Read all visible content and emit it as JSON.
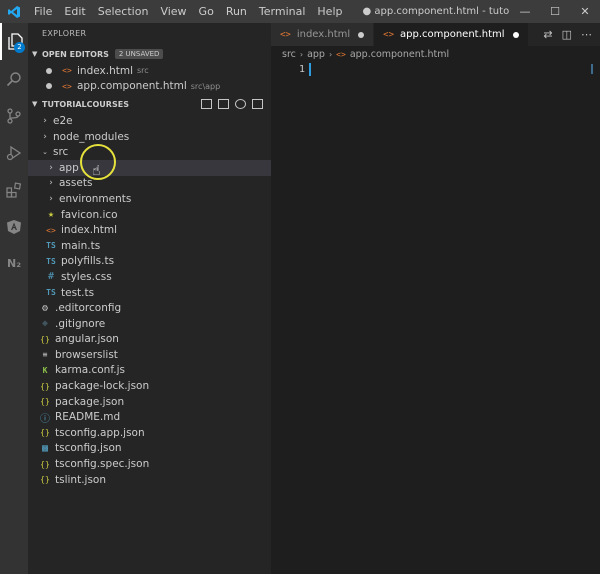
{
  "titlebar": {
    "menu": [
      "File",
      "Edit",
      "Selection",
      "View",
      "Go",
      "Run",
      "Terminal",
      "Help"
    ],
    "window_title": "● app.component.html - tutorialCourses - Visual Studio..."
  },
  "activity": {
    "explorer_badge": "2"
  },
  "sidebar": {
    "title": "EXPLORER",
    "open_editors": {
      "label": "OPEN EDITORS",
      "unsaved": "2 UNSAVED",
      "items": [
        {
          "name": "index.html",
          "path": "src"
        },
        {
          "name": "app.component.html",
          "path": "src\\app"
        }
      ]
    },
    "project": {
      "label": "TUTORIALCOURSES",
      "tree": [
        {
          "name": "e2e",
          "type": "folder"
        },
        {
          "name": "node_modules",
          "type": "folder"
        },
        {
          "name": "src",
          "type": "folder-open"
        },
        {
          "name": "app",
          "type": "folder"
        },
        {
          "name": "assets",
          "type": "folder"
        },
        {
          "name": "environments",
          "type": "folder"
        },
        {
          "name": "favicon.ico",
          "type": "star"
        },
        {
          "name": "index.html",
          "type": "html"
        },
        {
          "name": "main.ts",
          "type": "ts"
        },
        {
          "name": "polyfills.ts",
          "type": "ts"
        },
        {
          "name": "styles.css",
          "type": "css"
        },
        {
          "name": "test.ts",
          "type": "ts"
        },
        {
          "name": ".editorconfig",
          "type": "gear"
        },
        {
          "name": ".gitignore",
          "type": "git"
        },
        {
          "name": "angular.json",
          "type": "json"
        },
        {
          "name": "browserslist",
          "type": "list"
        },
        {
          "name": "karma.conf.js",
          "type": "karma"
        },
        {
          "name": "package-lock.json",
          "type": "json"
        },
        {
          "name": "package.json",
          "type": "json"
        },
        {
          "name": "README.md",
          "type": "info"
        },
        {
          "name": "tsconfig.app.json",
          "type": "json"
        },
        {
          "name": "tsconfig.json",
          "type": "tsconfig"
        },
        {
          "name": "tsconfig.spec.json",
          "type": "json"
        },
        {
          "name": "tslint.json",
          "type": "json"
        }
      ]
    }
  },
  "editor": {
    "tabs": [
      {
        "label": "index.html",
        "active": false
      },
      {
        "label": "app.component.html",
        "active": true
      }
    ],
    "breadcrumb": [
      "src",
      "app",
      "app.component.html"
    ],
    "line_number": "1"
  },
  "colors": {
    "accent": "#007acc",
    "html_icon": "#e37933",
    "ts_icon": "#519aba",
    "json_icon": "#cbcb41",
    "click_ring": "#e6e23c"
  }
}
